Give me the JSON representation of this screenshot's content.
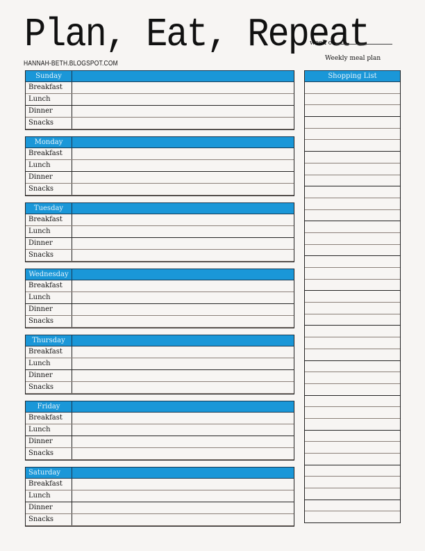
{
  "header": {
    "title": "Plan, Eat, Repeat",
    "blog": "HANNAH-BETH.BLOGSPOT.COM",
    "week_of_label": "week of",
    "subtitle": "Weekly meal plan"
  },
  "theme": {
    "accent": "#1a97d8",
    "border": "#222222",
    "rule": "#8a7f78"
  },
  "meals": [
    "Breakfast",
    "Lunch",
    "Dinner",
    "Snacks"
  ],
  "days": [
    {
      "name": "Sunday"
    },
    {
      "name": "Monday"
    },
    {
      "name": "Tuesday"
    },
    {
      "name": "Wednesday"
    },
    {
      "name": "Thursday"
    },
    {
      "name": "Friday"
    },
    {
      "name": "Saturday"
    }
  ],
  "shopping_list": {
    "title": "Shopping List",
    "line_count": 38
  }
}
